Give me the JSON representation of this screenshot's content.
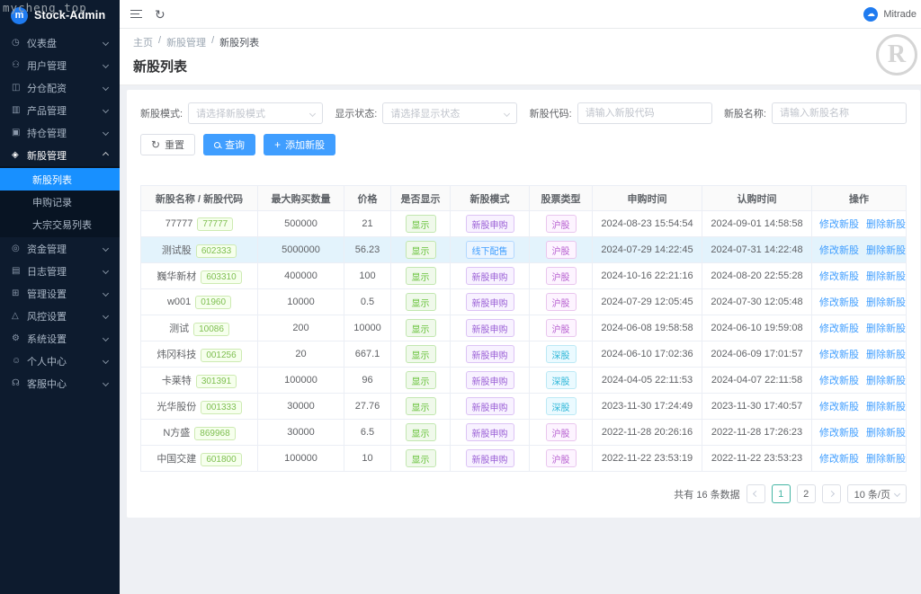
{
  "colors": {
    "accent": "#409eff",
    "menu_active": "#1890ff",
    "sidebar_bg": "#0d1b2e",
    "submenu_bg": "#081423",
    "logo_blue": "#1f7bf0",
    "pager_active": "#44b5a4"
  },
  "watermarks": {
    "site": "mycheng.top",
    "registered": "R"
  },
  "sidebar": {
    "logo": {
      "badge": "m",
      "title": "Stock-Admin"
    },
    "items": [
      {
        "key": "dashboard",
        "icon": "dashboard-icon",
        "glyph": "◷",
        "label": "仪表盘"
      },
      {
        "key": "users",
        "icon": "users-icon",
        "glyph": "⚇",
        "label": "用户管理"
      },
      {
        "key": "allocation",
        "icon": "allocation-icon",
        "glyph": "◫",
        "label": "分仓配资"
      },
      {
        "key": "products",
        "icon": "products-icon",
        "glyph": "▥",
        "label": "产品管理"
      },
      {
        "key": "positions",
        "icon": "positions-icon",
        "glyph": "▣",
        "label": "持仓管理"
      },
      {
        "key": "new-stock",
        "icon": "new-stock-icon",
        "glyph": "◈",
        "label": "新股管理",
        "expanded": true,
        "active": true,
        "children": [
          {
            "key": "new-stock-list",
            "label": "新股列表",
            "active": true
          },
          {
            "key": "subscribe-records",
            "label": "申购记录",
            "active": false
          },
          {
            "key": "block-trade-list",
            "label": "大宗交易列表",
            "active": false
          }
        ]
      },
      {
        "key": "funds",
        "icon": "funds-icon",
        "glyph": "◎",
        "label": "资金管理"
      },
      {
        "key": "logs",
        "icon": "logs-icon",
        "glyph": "▤",
        "label": "日志管理"
      },
      {
        "key": "admin-settings",
        "icon": "admin-settings-icon",
        "glyph": "⊞",
        "label": "管理设置"
      },
      {
        "key": "risk-settings",
        "icon": "risk-icon",
        "glyph": "△",
        "label": "风控设置"
      },
      {
        "key": "system-settings",
        "icon": "system-icon",
        "glyph": "⚙",
        "label": "系统设置"
      },
      {
        "key": "profile",
        "icon": "profile-icon",
        "glyph": "☺",
        "label": "个人中心"
      },
      {
        "key": "support",
        "icon": "support-icon",
        "glyph": "☊",
        "label": "客服中心"
      }
    ]
  },
  "header": {
    "user": "Mitrade",
    "avatar_glyph": "☁"
  },
  "breadcrumb": {
    "items": [
      "主页",
      "新股管理",
      "新股列表"
    ],
    "separator": "/"
  },
  "page": {
    "title": "新股列表"
  },
  "filters": {
    "mode_label": "新股模式:",
    "mode_placeholder": "请选择新股模式",
    "status_label": "显示状态:",
    "status_placeholder": "请选择显示状态",
    "code_label": "新股代码:",
    "code_placeholder": "请输入新股代码",
    "name_label": "新股名称:",
    "name_placeholder": "请输入新股名称",
    "reset_label": "重置",
    "search_label": "查询",
    "add_label": "添加新股"
  },
  "table": {
    "headers": [
      "新股名称 / 新股代码",
      "最大购买数量",
      "价格",
      "是否显示",
      "新股模式",
      "股票类型",
      "申购时间",
      "认购时间",
      "操作"
    ],
    "action_labels": [
      "修改新股",
      "删除新股"
    ],
    "rows": [
      {
        "name": "77777",
        "code": "77777",
        "max_buy": "500000",
        "price": "21",
        "visible": "显示",
        "mode": "新股申购",
        "mode_style": "purple",
        "stock_type": "沪股",
        "type_style": "magenta",
        "apply_time": "2024-08-23 15:54:54",
        "subscribe_time": "2024-09-01 14:58:58",
        "highlight": false
      },
      {
        "name": "测试股",
        "code": "602333",
        "max_buy": "5000000",
        "price": "56.23",
        "visible": "显示",
        "mode": "线下配售",
        "mode_style": "blue",
        "stock_type": "沪股",
        "type_style": "magenta",
        "apply_time": "2024-07-29 14:22:45",
        "subscribe_time": "2024-07-31 14:22:48",
        "highlight": true
      },
      {
        "name": "巍华新材",
        "code": "603310",
        "max_buy": "400000",
        "price": "100",
        "visible": "显示",
        "mode": "新股申购",
        "mode_style": "purple",
        "stock_type": "沪股",
        "type_style": "magenta",
        "apply_time": "2024-10-16 22:21:16",
        "subscribe_time": "2024-08-20 22:55:28",
        "highlight": false
      },
      {
        "name": "w001",
        "code": "01960",
        "max_buy": "10000",
        "price": "0.5",
        "visible": "显示",
        "mode": "新股申购",
        "mode_style": "purple",
        "stock_type": "沪股",
        "type_style": "magenta",
        "apply_time": "2024-07-29 12:05:45",
        "subscribe_time": "2024-07-30 12:05:48",
        "highlight": false
      },
      {
        "name": "测试",
        "code": "10086",
        "max_buy": "200",
        "price": "10000",
        "visible": "显示",
        "mode": "新股申购",
        "mode_style": "purple",
        "stock_type": "沪股",
        "type_style": "magenta",
        "apply_time": "2024-06-08 19:58:58",
        "subscribe_time": "2024-06-10 19:59:08",
        "highlight": false
      },
      {
        "name": "炜冈科技",
        "code": "001256",
        "max_buy": "20",
        "price": "667.1",
        "visible": "显示",
        "mode": "新股申购",
        "mode_style": "purple",
        "stock_type": "深股",
        "type_style": "cyan",
        "apply_time": "2024-06-10 17:02:36",
        "subscribe_time": "2024-06-09 17:01:57",
        "highlight": false
      },
      {
        "name": "卡莱特",
        "code": "301391",
        "max_buy": "100000",
        "price": "96",
        "visible": "显示",
        "mode": "新股申购",
        "mode_style": "purple",
        "stock_type": "深股",
        "type_style": "cyan",
        "apply_time": "2024-04-05 22:11:53",
        "subscribe_time": "2024-04-07 22:11:58",
        "highlight": false
      },
      {
        "name": "光华股份",
        "code": "001333",
        "max_buy": "30000",
        "price": "27.76",
        "visible": "显示",
        "mode": "新股申购",
        "mode_style": "purple",
        "stock_type": "深股",
        "type_style": "cyan",
        "apply_time": "2023-11-30 17:24:49",
        "subscribe_time": "2023-11-30 17:40:57",
        "highlight": false
      },
      {
        "name": "N方盛",
        "code": "869968",
        "max_buy": "30000",
        "price": "6.5",
        "visible": "显示",
        "mode": "新股申购",
        "mode_style": "purple",
        "stock_type": "沪股",
        "type_style": "magenta",
        "apply_time": "2022-11-28 20:26:16",
        "subscribe_time": "2022-11-28 17:26:23",
        "highlight": false
      },
      {
        "name": "中国交建",
        "code": "601800",
        "max_buy": "100000",
        "price": "10",
        "visible": "显示",
        "mode": "新股申购",
        "mode_style": "purple",
        "stock_type": "沪股",
        "type_style": "magenta",
        "apply_time": "2022-11-22 23:53:19",
        "subscribe_time": "2022-11-22 23:53:23",
        "highlight": false
      }
    ]
  },
  "pagination": {
    "total_text": "共有 16 条数据",
    "pages": [
      "1",
      "2"
    ],
    "current": "1",
    "page_size": "10 条/页"
  }
}
